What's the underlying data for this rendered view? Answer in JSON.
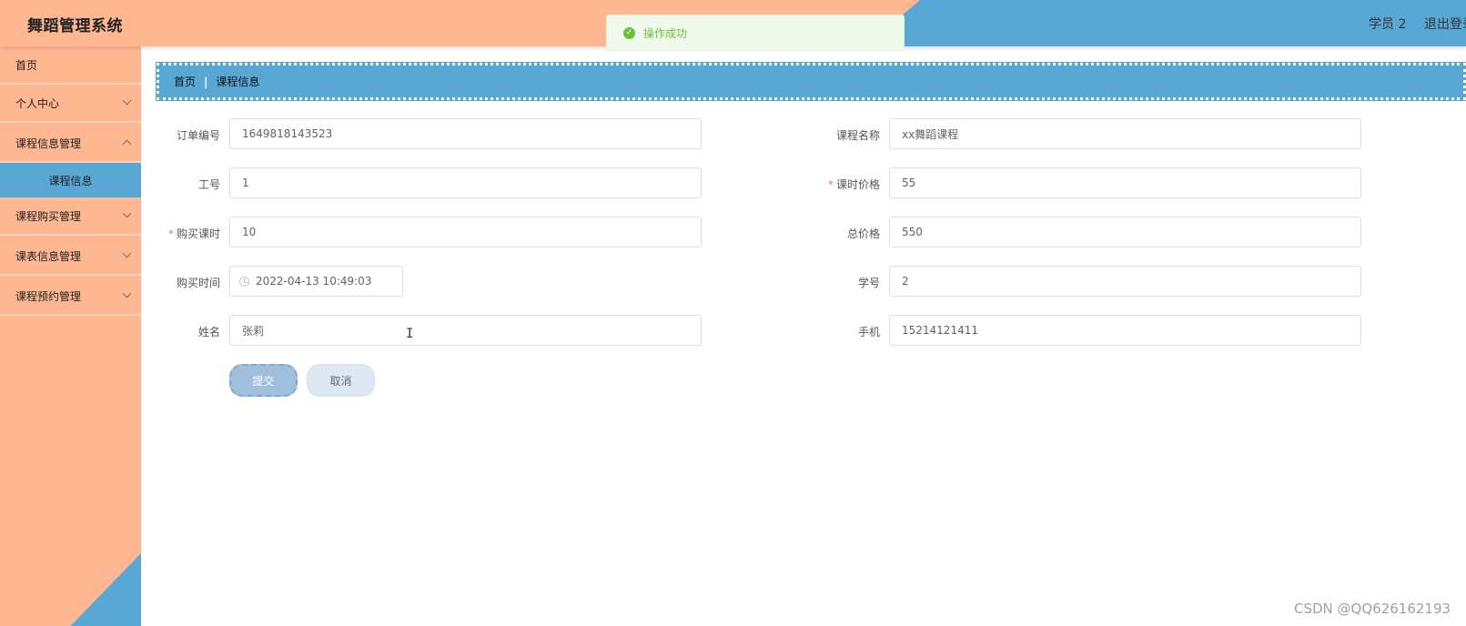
{
  "header": {
    "app_title": "舞蹈管理系统",
    "user_name": "学员 2",
    "logout": "退出登录"
  },
  "toast": {
    "message": "操作成功"
  },
  "sidebar": {
    "items": [
      {
        "label": "首页"
      },
      {
        "label": "个人中心"
      },
      {
        "label": "课程信息管理"
      },
      {
        "label": "课程信息"
      },
      {
        "label": "课程购买管理"
      },
      {
        "label": "课表信息管理"
      },
      {
        "label": "课程预约管理"
      }
    ]
  },
  "breadcrumb": {
    "home": "首页",
    "current": "课程信息"
  },
  "form": {
    "order_no": {
      "label": "订单编号",
      "value": "1649818143523"
    },
    "course_name": {
      "label": "课程名称",
      "value": "xx舞蹈课程"
    },
    "staff_no": {
      "label": "工号",
      "value": "1"
    },
    "lesson_price": {
      "label": "课时价格",
      "value": "55"
    },
    "purchased_hours": {
      "label": "购买课时",
      "value": "10"
    },
    "total_price": {
      "label": "总价格",
      "value": "550"
    },
    "purchase_time": {
      "label": "购买时间",
      "value": "2022-04-13 10:49:03"
    },
    "student_no": {
      "label": "学号",
      "value": "2"
    },
    "name": {
      "label": "姓名",
      "value": "张莉"
    },
    "phone": {
      "label": "手机",
      "value": "15214121411"
    },
    "required_mark": "*",
    "submit": "提交",
    "cancel": "取消"
  },
  "watermark": "CSDN @QQ626162193",
  "colors": {
    "peach": "#ffb792",
    "blue": "#58a7d5",
    "success": "#67c23a"
  }
}
